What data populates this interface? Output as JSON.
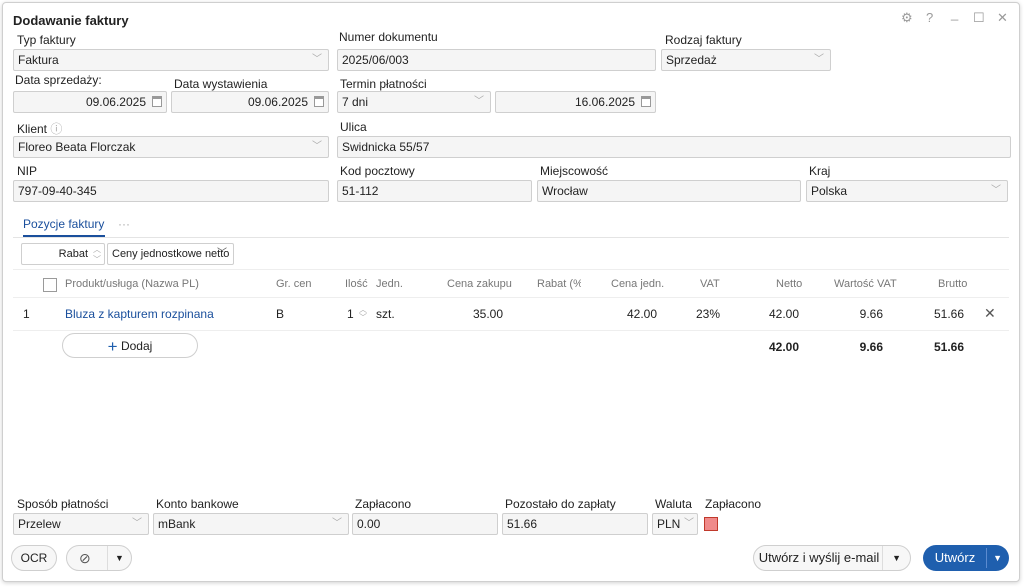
{
  "window": {
    "title": "Dodawanie faktury",
    "controls": [
      "⚙",
      "?",
      "_",
      "☐",
      "✕"
    ]
  },
  "form": {
    "typ_faktury": {
      "label": "Typ faktury",
      "value": "Faktura"
    },
    "numer_dokumentu": {
      "label": "Numer dokumentu",
      "value": "2025/06/003"
    },
    "rodzaj_faktury": {
      "label": "Rodzaj faktury",
      "value": "Sprzedaż"
    },
    "data_sprzedazy": {
      "label": "Data sprzedaży:",
      "value": "09.06.2025"
    },
    "data_wystawienia": {
      "label": "Data wystawienia",
      "value": "09.06.2025"
    },
    "termin_platnosci": {
      "label": "Termin płatności",
      "value": "7 dni",
      "date": "16.06.2025"
    },
    "klient": {
      "label": "Klient",
      "info_icon": "ⓘ",
      "value": "Floreo Beata Florczak"
    },
    "ulica": {
      "label": "Ulica",
      "value": "Swidnicka 55/57"
    },
    "nip": {
      "label": "NIP",
      "value": "797-09-40-345"
    },
    "kod_pocztowy": {
      "label": "Kod pocztowy",
      "value": "51-112"
    },
    "miejscowosc": {
      "label": "Miejscowość",
      "value": "Wrocław"
    },
    "kraj": {
      "label": "Kraj",
      "value": "Polska"
    }
  },
  "tabs": {
    "active": "Pozycje faktury",
    "more": "···"
  },
  "toolbar": {
    "rabat_label": "Rabat",
    "price_mode": "Ceny jednostkowe netto"
  },
  "table": {
    "headers": {
      "product": "Produkt/usługa (Nazwa PL)",
      "gr_cen": "Gr. cen",
      "ilosc": "Ilość",
      "jedn": "Jedn.",
      "cena_zakupu": "Cena zakupu",
      "rabat": "Rabat (%)",
      "cena_jedn": "Cena jedn.",
      "vat": "VAT",
      "netto": "Netto",
      "wartosc_vat": "Wartość VAT",
      "brutto": "Brutto"
    },
    "rows": [
      {
        "lp": "1",
        "product": "Bluza z kapturem rozpinana",
        "gr_cen": "B",
        "ilosc": "1",
        "jedn": "szt.",
        "cena_zakupu": "35.00",
        "rabat": "",
        "cena_jedn": "42.00",
        "vat": "23%",
        "netto": "42.00",
        "wartosc_vat": "9.66",
        "brutto": "51.66"
      }
    ],
    "add_label": "Dodaj",
    "totals": {
      "netto": "42.00",
      "wartosc_vat": "9.66",
      "brutto": "51.66"
    }
  },
  "payment": {
    "sposob": {
      "label": "Sposób płatności",
      "value": "Przelew"
    },
    "konto": {
      "label": "Konto bankowe",
      "value": "mBank"
    },
    "zaplacono": {
      "label": "Zapłacono",
      "value": "0.00"
    },
    "pozostalo": {
      "label": "Pozostało do zapłaty",
      "value": "51.66"
    },
    "waluta": {
      "label": "Waluta",
      "value": "PLN"
    },
    "zaplacono_flag": {
      "label": "Zapłacono"
    }
  },
  "footer": {
    "ocr_label": "OCR",
    "send_label": "Utwórz i wyślij e-mail",
    "create_label": "Utwórz"
  },
  "colors": {
    "primary": "#1f5fae",
    "link": "#1a4f9c",
    "paid_flag": "#f08a8a"
  }
}
